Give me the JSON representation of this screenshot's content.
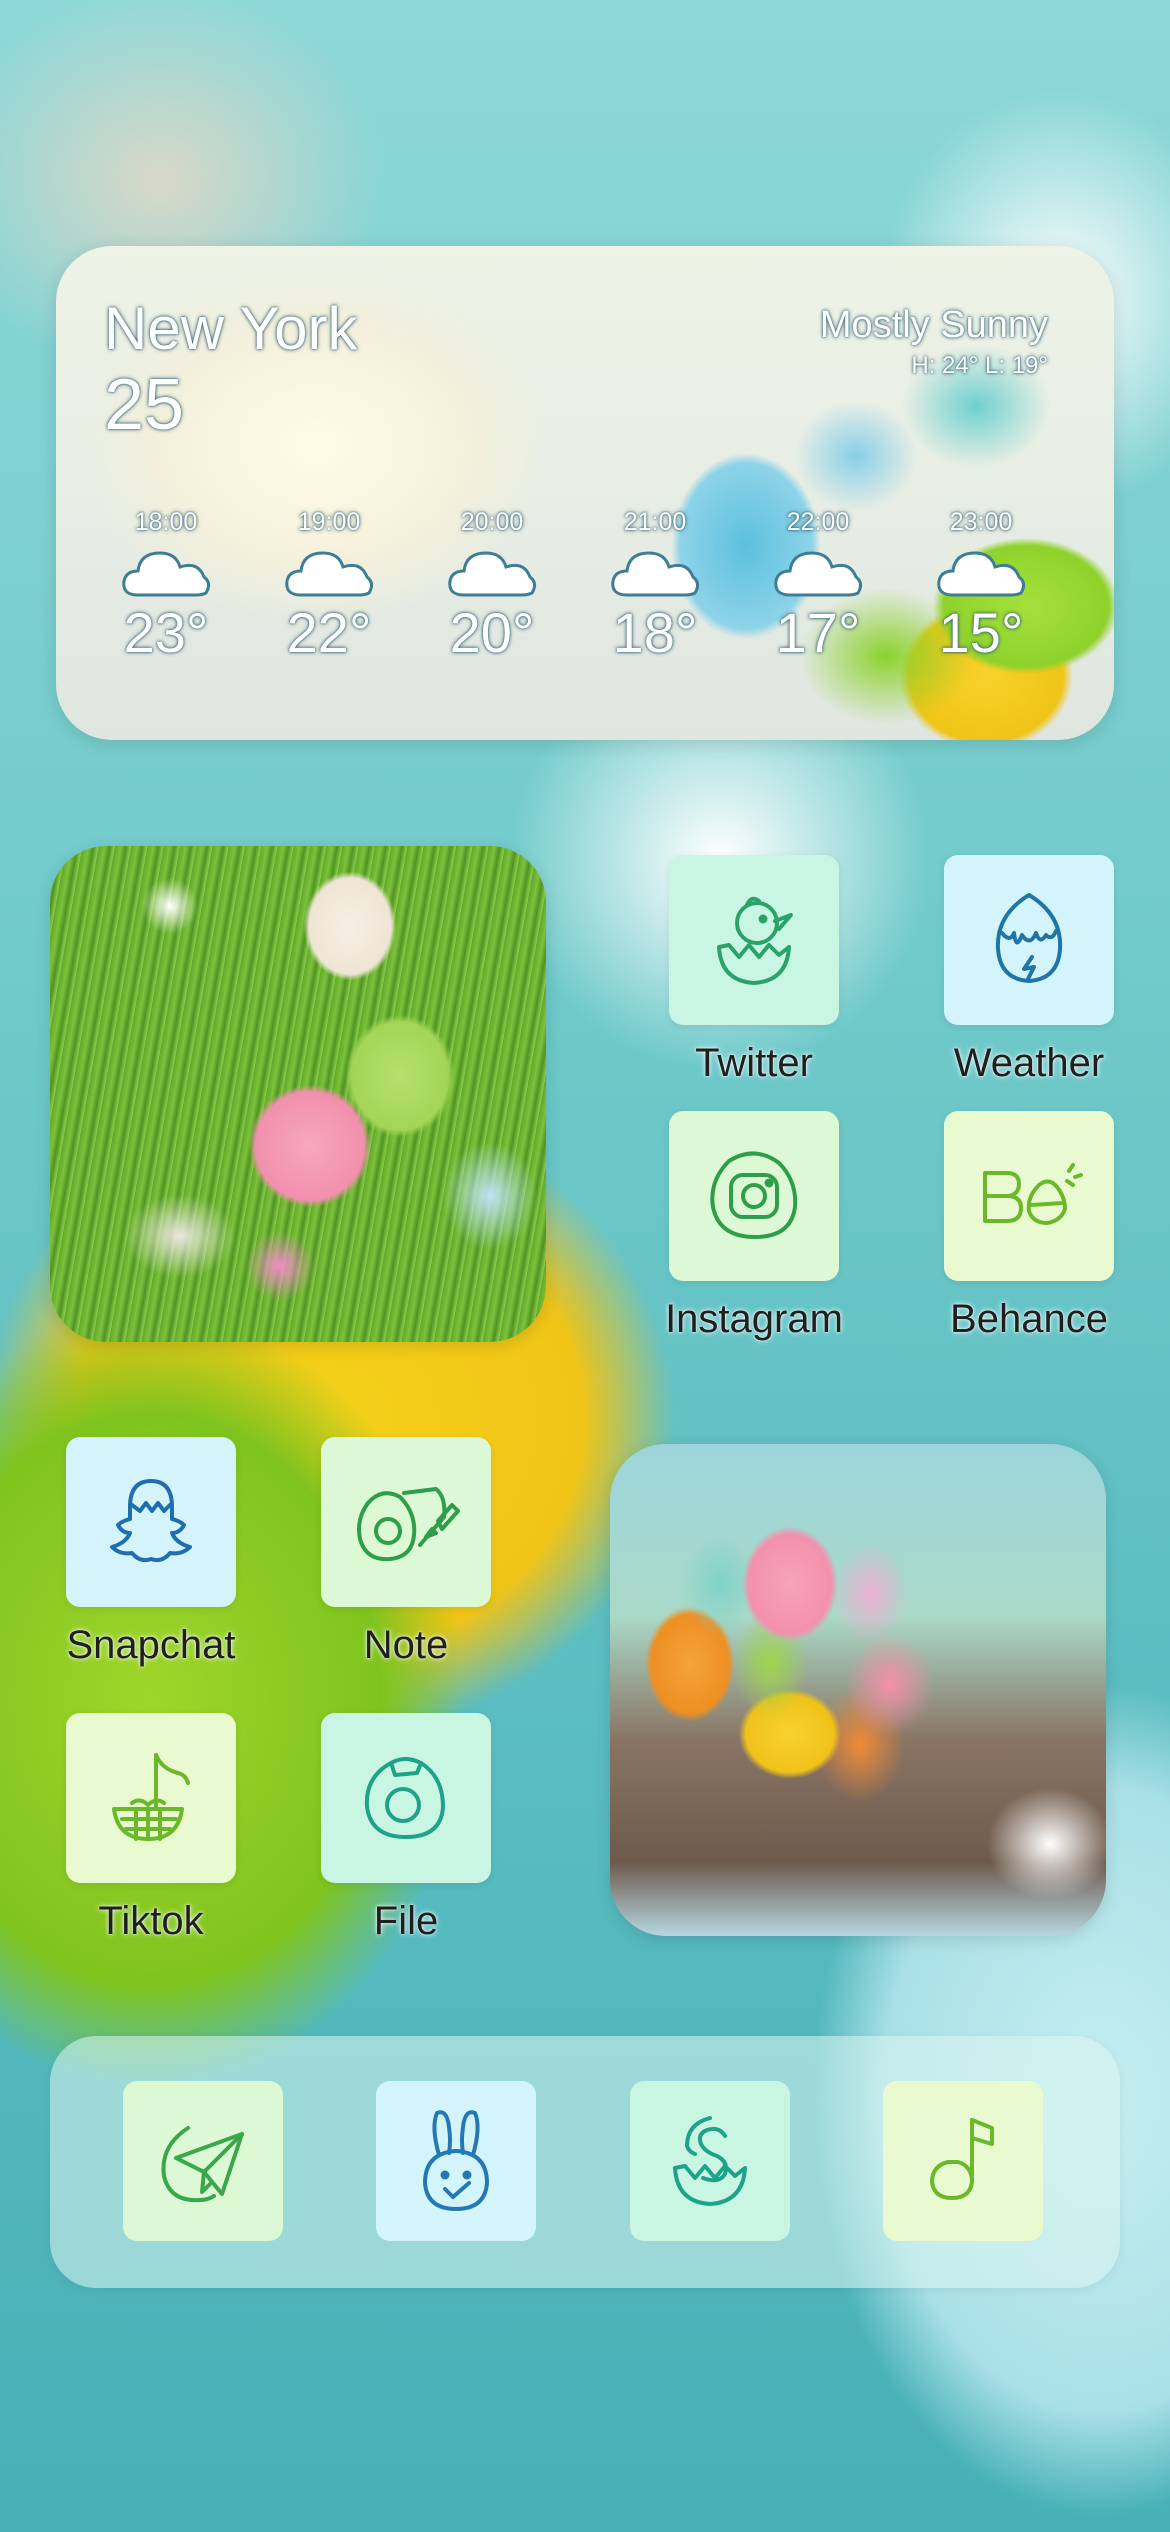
{
  "weather": {
    "city": "New York",
    "current_temp": "25",
    "condition": "Mostly Sunny",
    "high_low": "H: 24° L: 19°",
    "hourly": [
      {
        "time": "18:00",
        "temp": "23°",
        "icon": "cloud-icon"
      },
      {
        "time": "19:00",
        "temp": "22°",
        "icon": "cloud-icon"
      },
      {
        "time": "20:00",
        "temp": "20°",
        "icon": "cloud-icon"
      },
      {
        "time": "21:00",
        "temp": "18°",
        "icon": "cloud-icon"
      },
      {
        "time": "22:00",
        "temp": "17°",
        "icon": "cloud-icon"
      },
      {
        "time": "23:00",
        "temp": "15°",
        "icon": "cloud-icon"
      }
    ]
  },
  "apps": {
    "twitter": {
      "label": "Twitter",
      "icon": "hatching-chick-icon",
      "color": "#c9f5e3"
    },
    "weather": {
      "label": "Weather",
      "icon": "dripping-egg-icon",
      "color": "#d3f4fb"
    },
    "instagram": {
      "label": "Instagram",
      "icon": "camera-egg-icon",
      "color": "#dcf8d4"
    },
    "behance": {
      "label": "Behance",
      "icon": "behance-egg-icon",
      "color": "#eafad0"
    },
    "snapchat": {
      "label": "Snapchat",
      "icon": "ghost-egg-icon",
      "color": "#d5f3fb"
    },
    "note": {
      "label": "Note",
      "icon": "notebook-egg-icon",
      "color": "#dcf8d4"
    },
    "tiktok": {
      "label": "Tiktok",
      "icon": "music-note-basket-icon",
      "color": "#eafad0"
    },
    "file": {
      "label": "File",
      "icon": "folder-egg-icon",
      "color": "#c9f5e3"
    }
  },
  "dock": [
    {
      "name": "telegram",
      "icon": "paper-plane-icon",
      "color": "#dcf8d4"
    },
    {
      "name": "bunny",
      "icon": "bunny-check-icon",
      "color": "#d3f4fb"
    },
    {
      "name": "skype",
      "icon": "egg-s-icon",
      "color": "#c9f5e3"
    },
    {
      "name": "music",
      "icon": "music-note-egg-icon",
      "color": "#eafad0"
    }
  ]
}
